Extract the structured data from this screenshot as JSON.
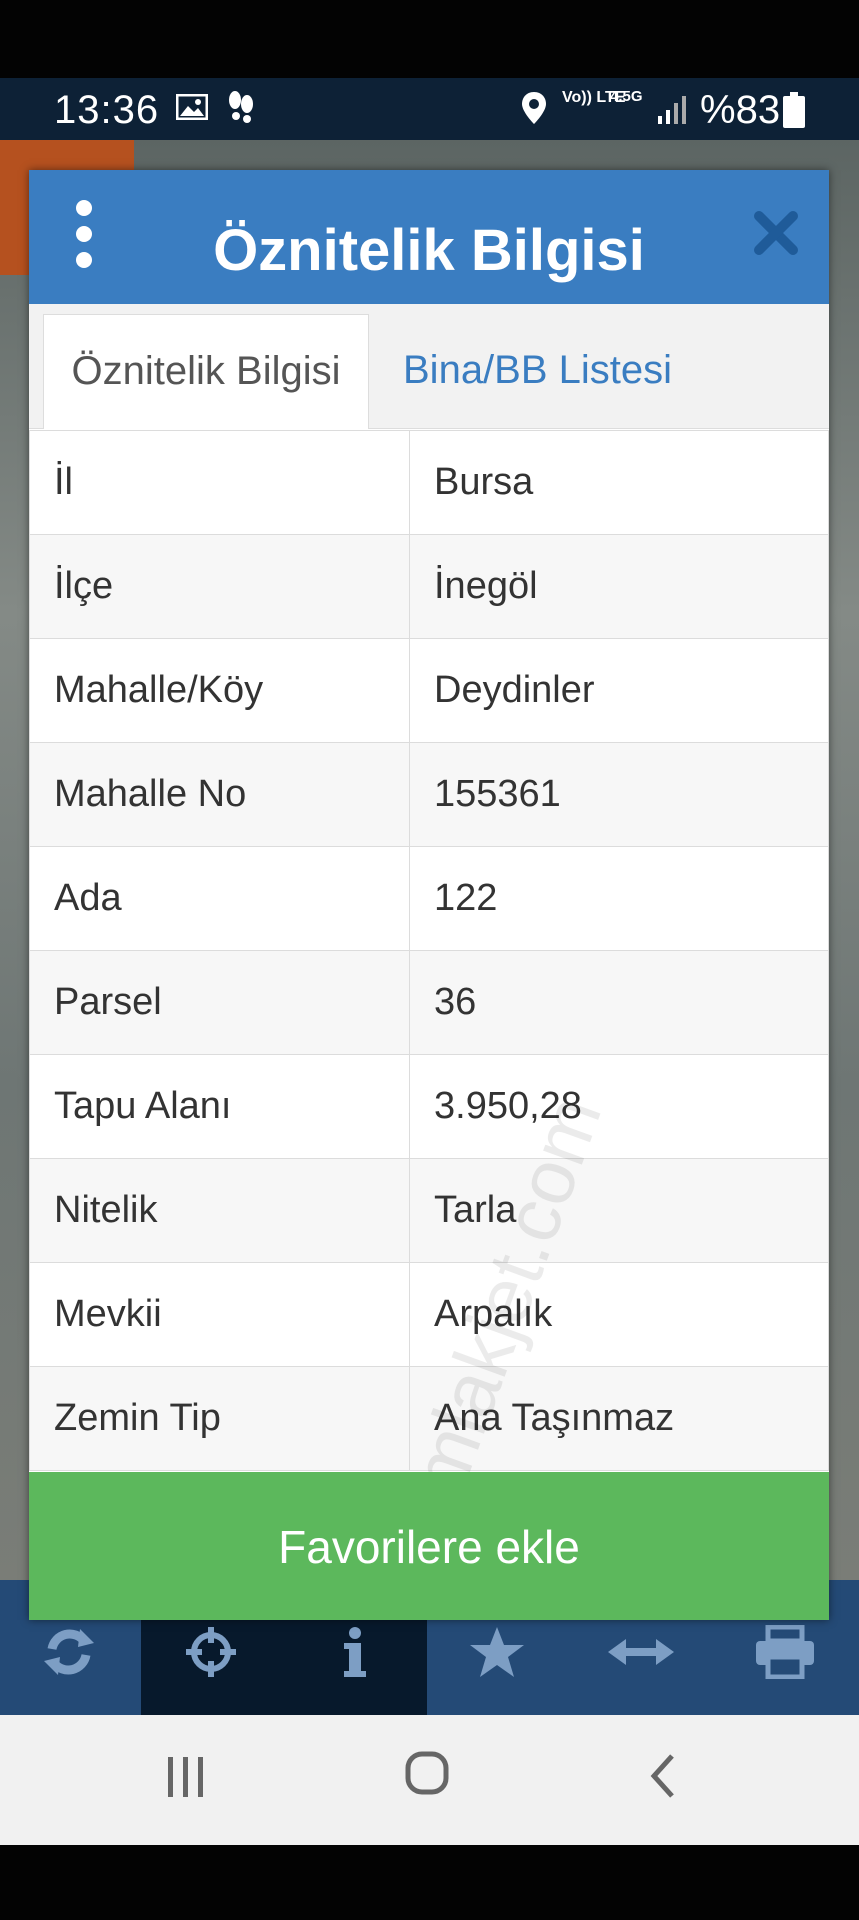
{
  "status": {
    "time": "13:36",
    "network_volte": "Vo)) LTE",
    "network_gen": "4.5G",
    "battery": "%83"
  },
  "dialog": {
    "title": "Öznitelik Bilgisi",
    "tabs": [
      {
        "label": "Öznitelik Bilgisi",
        "active": true
      },
      {
        "label": "Bina/BB Listesi",
        "active": false
      }
    ],
    "rows": [
      {
        "key": "İl",
        "value": "Bursa"
      },
      {
        "key": "İlçe",
        "value": "İnegöl"
      },
      {
        "key": "Mahalle/Köy",
        "value": "Deydinler"
      },
      {
        "key": "Mahalle No",
        "value": "155361"
      },
      {
        "key": "Ada",
        "value": "122"
      },
      {
        "key": "Parsel",
        "value": "36"
      },
      {
        "key": "Tapu Alanı",
        "value": "3.950,28"
      },
      {
        "key": "Nitelik",
        "value": "Tarla"
      },
      {
        "key": "Mevkii",
        "value": "Arpalık"
      },
      {
        "key": "Zemin Tip",
        "value": "Ana Taşınmaz"
      }
    ],
    "favorite_button": "Favorilere ekle"
  },
  "watermark": "emlakjet.com",
  "toolbar": [
    "refresh-icon",
    "crosshair-icon",
    "info-icon",
    "star-icon",
    "arrows-horizontal-icon",
    "print-icon"
  ],
  "colors": {
    "header": "#3a7dc1",
    "button": "#5cb85c",
    "status_bar": "#0d2136"
  }
}
